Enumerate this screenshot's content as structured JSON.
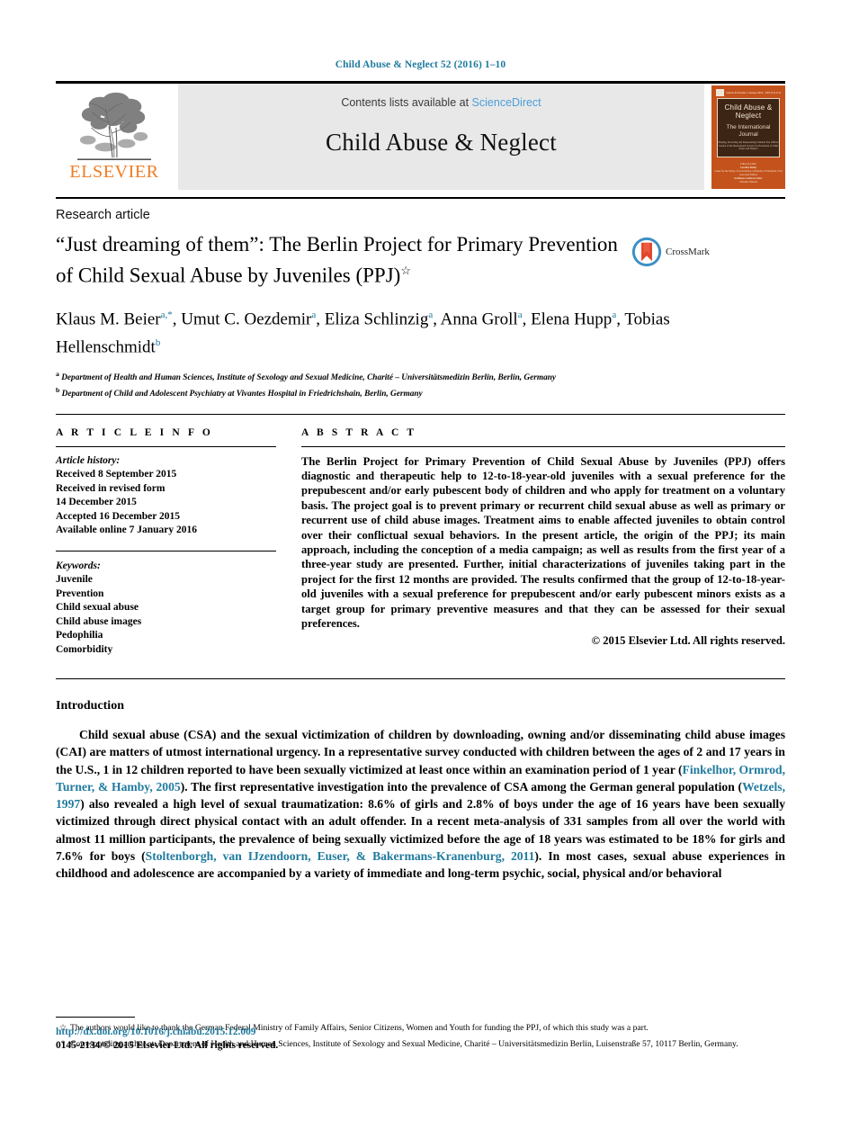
{
  "running_head": "Child Abuse & Neglect 52 (2016) 1–10",
  "masthead": {
    "publisher_wordmark": "ELSEVIER",
    "contents_prefix": "Contents lists available at",
    "contents_link": "ScienceDirect",
    "journal_title": "Child Abuse & Neglect",
    "cover": {
      "top_left_text": "",
      "top_middle_text": "Volume 52  Number 1  January 2016",
      "top_right_text": "ISSN 0145-2134",
      "name": "Child Abuse & Neglect",
      "subtitle": "The International Journal",
      "micro": "Helping, Protecting and Representing Children\nThe Official Journal of the International Society\nfor Prevention of Child Abuse and Neglect",
      "editor_label": "Editor-in-Chief",
      "editor_name": "Caroline Bailey",
      "editor_affiliation": "Center for the Study of Social Policy, University of Maryland, USA",
      "assoc_label": "Associate Editors",
      "assoc_a": "Kathleen Coulborn Faller",
      "assoc_b": "Christine Wekerle"
    }
  },
  "article": {
    "type": "Research article",
    "title": "“Just dreaming of them”: The Berlin Project for Primary Prevention of Child Sexual Abuse by Juveniles (PPJ)",
    "title_footnote_mark": "☆",
    "crossmark_label": "CrossMark",
    "authors_html": "Klaus M. Beier<sup>a,*</sup>, Umut C. Oezdemir<sup>a</sup>, Eliza Schlinzig<sup>a</sup>, Anna Groll<sup>a</sup>, Elena Hupp<sup>a</sup>, Tobias Hellenschmidt<sup>b</sup>",
    "affiliation_a": "Department of Health and Human Sciences, Institute of Sexology and Sexual Medicine, Charité – Universitätsmedizin Berlin, Berlin, Germany",
    "affiliation_b": "Department of Child and Adolescent Psychiatry at Vivantes Hospital in Friedrichshain, Berlin, Germany",
    "affiliation_a_mark": "a",
    "affiliation_b_mark": "b"
  },
  "info": {
    "heading": "A R T I C L E   I N F O",
    "history_label": "Article history:",
    "history": [
      "Received 8 September 2015",
      "Received in revised form",
      "14 December 2015",
      "Accepted 16 December 2015",
      "Available online 7 January 2016"
    ],
    "keywords_label": "Keywords:",
    "keywords": [
      "Juvenile",
      "Prevention",
      "Child sexual abuse",
      "Child abuse images",
      "Pedophilia",
      "Comorbidity"
    ]
  },
  "abstract": {
    "heading": "A B S T R A C T",
    "text": "The Berlin Project for Primary Prevention of Child Sexual Abuse by Juveniles (PPJ) offers diagnostic and therapeutic help to 12-to-18-year-old juveniles with a sexual preference for the prepubescent and/or early pubescent body of children and who apply for treatment on a voluntary basis. The project goal is to prevent primary or recurrent child sexual abuse as well as primary or recurrent use of child abuse images. Treatment aims to enable affected juveniles to obtain control over their conflictual sexual behaviors. In the present article, the origin of the PPJ; its main approach, including the conception of a media campaign; as well as results from the first year of a three-year study are presented. Further, initial characterizations of juveniles taking part in the project for the first 12 months are provided. The results confirmed that the group of 12-to-18-year-old juveniles with a sexual preference for prepubescent and/or early pubescent minors exists as a target group for primary preventive measures and that they can be assessed for their sexual preferences.",
    "copyright": "© 2015 Elsevier Ltd. All rights reserved."
  },
  "body": {
    "heading": "Introduction",
    "paragraph_parts": [
      {
        "t": "Child sexual abuse (CSA) and the sexual victimization of children by downloading, owning and/or disseminating child abuse images (CAI) are matters of utmost international urgency. In a representative survey conducted with children between the ages of 2 and 17 years in the U.S., 1 in 12 children reported to have been sexually victimized at least once within an examination period of 1 year (",
        "c": false
      },
      {
        "t": "Finkelhor, Ormrod, Turner, & Hamby, 2005",
        "c": true
      },
      {
        "t": "). The first representative investigation into the prevalence of CSA among the German general population (",
        "c": false
      },
      {
        "t": "Wetzels, 1997",
        "c": true
      },
      {
        "t": ") also revealed a high level of sexual traumatization: 8.6% of girls and 2.8% of boys under the age of 16 years have been sexually victimized through direct physical contact with an adult offender. In a recent meta-analysis of 331 samples from all over the world with almost 11 million participants, the prevalence of being sexually victimized before the age of 18 years was estimated to be 18% for girls and 7.6% for boys (",
        "c": false
      },
      {
        "t": "Stoltenborgh, van IJzendoorn, Euser, & Bakermans-Kranenburg, 2011",
        "c": true
      },
      {
        "t": "). In most cases, sexual abuse experiences in childhood and adolescence are accompanied by a variety of immediate and long-term psychic, social, physical and/or behavioral",
        "c": false
      }
    ]
  },
  "footnotes": {
    "funding_mark": "☆",
    "funding_text": "The authors would like to thank the German Federal Ministry of Family Affairs, Senior Citizens, Women and Youth for funding the PPJ, of which this study was a part.",
    "corresponding_mark": "*",
    "corresponding_text": "Corresponding author at: Department of Health and Human Sciences, Institute of Sexology and Sexual Medicine, Charité – Universitätsmedizin Berlin, Luisenstraße 57, 10117 Berlin, Germany."
  },
  "footer": {
    "doi": "http://dx.doi.org/10.1016/j.chiabu.2015.12.009",
    "issn_line": "0145-2134/© 2015 Elsevier Ltd. All rights reserved."
  },
  "colors": {
    "link_blue": "#1f7a9e",
    "sciencedirect_blue": "#4a9fd8",
    "elsevier_orange": "#F07C22",
    "cover_orange": "#C4521C",
    "cover_panel": "#3d2516",
    "banner_grey": "#e8e8e8"
  }
}
